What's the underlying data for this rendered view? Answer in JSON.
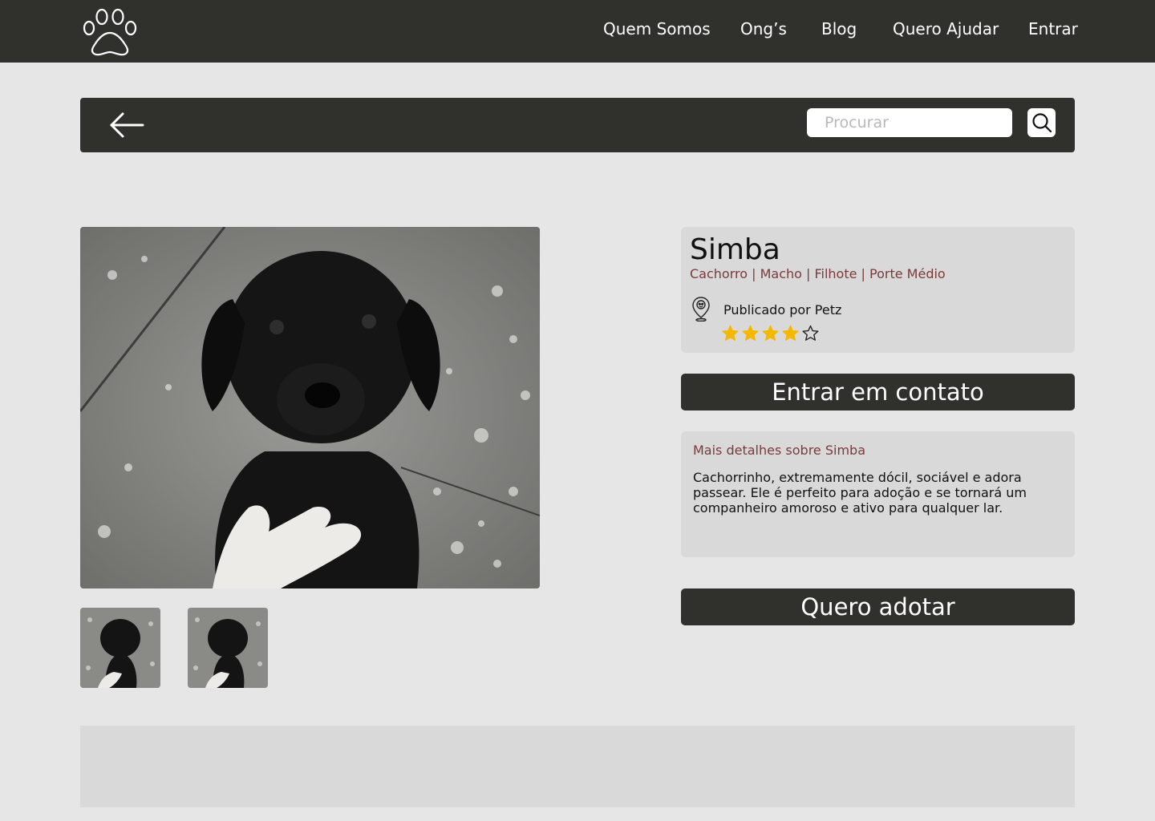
{
  "header": {
    "logo_icon": "paw-icon",
    "nav": [
      {
        "label": "Quem Somos"
      },
      {
        "label": "Ong’s"
      },
      {
        "label": "Blog"
      },
      {
        "label": "Quero Ajudar"
      },
      {
        "label": "Entrar"
      }
    ]
  },
  "search": {
    "back_icon": "arrow-left-icon",
    "placeholder": "Procurar",
    "value": "",
    "button_icon": "search-icon"
  },
  "gallery": {
    "main_photo": "black-puppy-photo",
    "thumbnails": [
      "black-puppy-thumbnail",
      "black-puppy-thumbnail"
    ]
  },
  "pet": {
    "name": "Simba",
    "tags": "Cachorro | Macho | Filhote | Porte Médio",
    "publisher_icon": "location-pin-icon",
    "published_by": "Publicado por Petz",
    "rating": 4,
    "rating_max": 5
  },
  "actions": {
    "contact_label": "Entrar em contato",
    "adopt_label": "Quero adotar"
  },
  "details": {
    "title": "Mais detalhes sobre Simba",
    "text": "Cachorrinho, extremamente dócil, sociável e adora passear. Ele é perfeito para adoção e se tornará um companheiro amoroso e ativo para qualquer lar."
  },
  "colors": {
    "dark": "#30302d",
    "background": "#e6e6e6",
    "card": "#d9d9d9",
    "accent_text": "#7b3a3a",
    "star": "#f5b800"
  }
}
